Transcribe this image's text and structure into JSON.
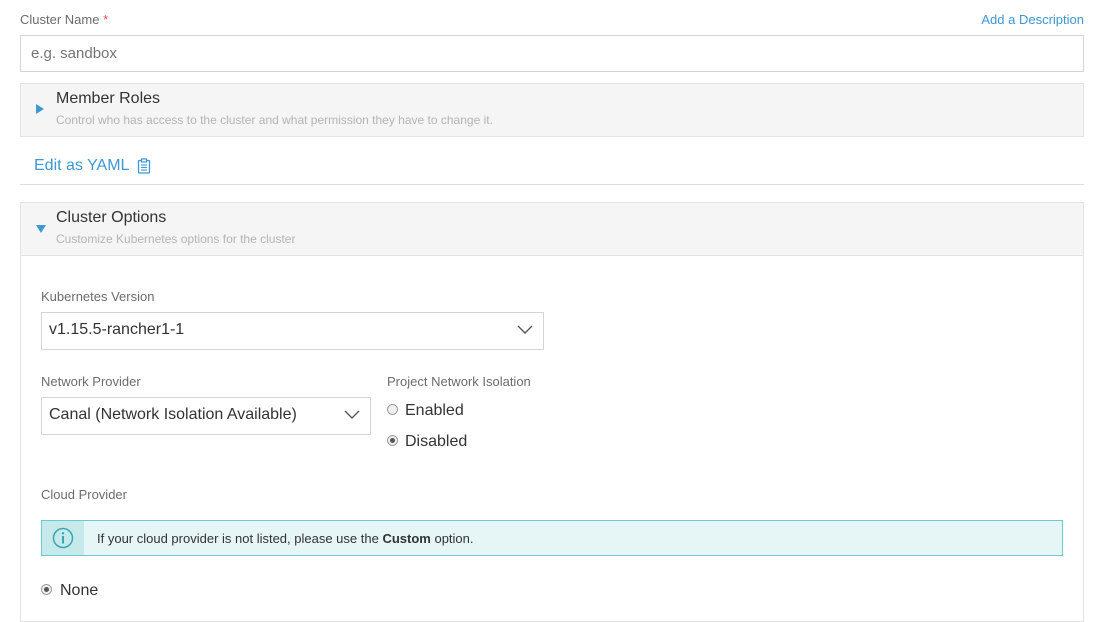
{
  "cluster_name": {
    "label": "Cluster Name",
    "required_mark": "*",
    "placeholder": "e.g. sandbox",
    "add_description": "Add a Description"
  },
  "member_roles": {
    "title": "Member Roles",
    "subtitle": "Control who has access to the cluster and what permission they have to change it."
  },
  "edit_yaml": {
    "label": "Edit as YAML",
    "icon": "clipboard-icon"
  },
  "cluster_options": {
    "title": "Cluster Options",
    "subtitle": "Customize Kubernetes options for the cluster",
    "kubernetes_version": {
      "label": "Kubernetes Version",
      "value": "v1.15.5-rancher1-1"
    },
    "network_provider": {
      "label": "Network Provider",
      "value": "Canal (Network Isolation Available)"
    },
    "project_network_isolation": {
      "label": "Project Network Isolation",
      "options": [
        {
          "label": "Enabled",
          "selected": false
        },
        {
          "label": "Disabled",
          "selected": true
        }
      ]
    },
    "cloud_provider": {
      "label": "Cloud Provider",
      "info_prefix": "If your cloud provider is not listed, please use the",
      "info_bold": "Custom",
      "info_suffix": "option.",
      "options": [
        {
          "label": "None",
          "selected": true
        }
      ]
    }
  },
  "colors": {
    "accent": "#3d98d3",
    "required": "#d9534f",
    "panel_bg": "#f5f5f5",
    "info_bg": "#e6f5f6",
    "info_border": "#6ec9cf"
  }
}
